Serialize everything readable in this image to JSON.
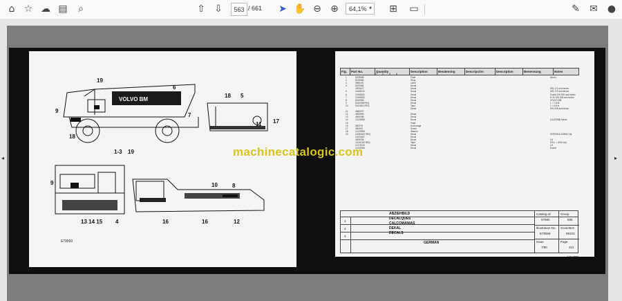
{
  "toolbar": {
    "page_current": "563",
    "page_total": "/ 661",
    "zoom": "64,1%"
  },
  "watermark": "machinecatalogic.com",
  "left_page": {
    "truck_brand": "VOLVO BM",
    "callouts": [
      "19",
      "6",
      "9",
      "7",
      "18",
      "1-3",
      "19",
      "18",
      "5",
      "11",
      "17",
      "9",
      "8",
      "10",
      "13 14 15",
      "4",
      "16",
      "16",
      "12"
    ],
    "drawing_code": "E79550"
  },
  "right_page": {
    "headers": [
      "Fig.",
      "Part No.",
      "Quantity",
      "1",
      "2",
      "3",
      "4",
      "Description",
      "Benämning",
      "Descripción",
      "Description",
      "Benennung",
      "Notes"
    ],
    "part_numbers": [
      "5229585",
      "5229586",
      "4969191",
      "5229584",
      "4993670",
      "11068741",
      "11068181",
      "11068182",
      "5242596",
      "5242098 REQ",
      "5241801 REQ",
      "",
      "4969207",
      "4952999",
      "4849185",
      "11025956",
      "",
      "350276",
      "350493",
      "11025955",
      "12083467 REQ",
      "11001487",
      "4969206",
      "11031180 REQ",
      "11172049",
      "11102366"
    ],
    "figs": [
      "1",
      "2",
      "3",
      "4",
      "",
      "5",
      "6",
      "7",
      "8",
      "9",
      "10",
      "",
      "11",
      "12",
      "13",
      "14",
      "15",
      "16",
      "17",
      "18",
      "19"
    ],
    "descriptions": [
      "Plate",
      "Shop",
      "Label",
      "Decal",
      "Decal",
      "Decal",
      "Decal",
      "Decal",
      "Decal",
      "Decal",
      "Tape",
      "Decal",
      "",
      "Decal",
      "Decal",
      "Decal",
      "Plate",
      "Anchorage",
      "Screw",
      "Washer",
      "Decal",
      "Decal",
      "Decal",
      "Tape",
      "Decal",
      "Decal"
    ],
    "notes": [
      "Namn",
      "",
      "",
      "",
      "S/N 171 and below",
      "S/N 172 and above",
      "Euclid S/N 535 and below",
      "R 32 S/N 535 and below",
      "VOLVO BM",
      "L = 7.5 M",
      "L = 4.6 m",
      "S/N 535 and below",
      "",
      "",
      "",
      "(114200M) Name",
      "",
      "",
      "",
      "",
      "SVENSKA SOBM-Opt",
      "",
      "LH",
      "S/N L = 60M-Opt",
      "LH",
      "Euclid"
    ],
    "title_block": {
      "titles": [
        "ABZIEHBILD",
        "DECALQUES",
        "CALCOMANIAS",
        "DEKAL",
        "DECALS"
      ],
      "rev_numbers": [
        "1",
        "2",
        "3"
      ],
      "language": "GERMAN",
      "catalog_label": "Catalog Id",
      "catalog_value": "97680",
      "group_label": "Group",
      "group_value": "588",
      "illustration_label": "Illustration No.",
      "illustration_value": "E79556",
      "scan_label": "Scan/Item",
      "scan_value": "89103",
      "issue_label": "Issue",
      "issue_value": "7/90",
      "page_label": "Page",
      "page_value": "321",
      "model": "351TD"
    }
  }
}
